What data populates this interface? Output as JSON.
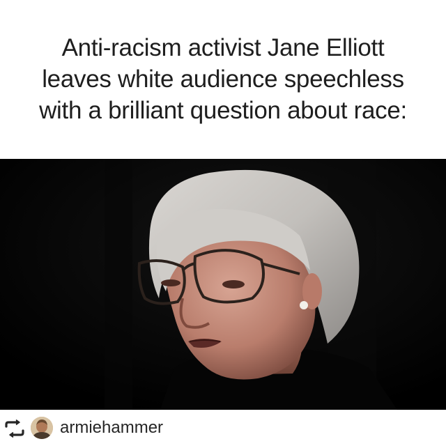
{
  "caption": {
    "line1": "Anti-racism activist Jane Elliott",
    "line2": "leaves white audience speechless",
    "line3": "with a brilliant question about race:"
  },
  "video": {
    "subject": "woman-with-glasses"
  },
  "repost": {
    "icon": "repost-icon",
    "username": "armiehammer"
  },
  "colors": {
    "caption_text": "#1e1e1e",
    "video_background": "#000000",
    "username_text": "#262626"
  }
}
